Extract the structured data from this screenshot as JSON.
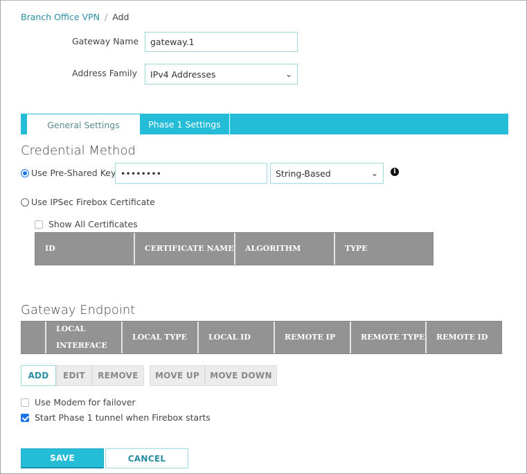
{
  "breadcrumb": {
    "parent": "Branch Office VPN",
    "separator": "/",
    "current": "Add"
  },
  "form": {
    "gateway_name_label": "Gateway Name",
    "gateway_name_value": "gateway.1",
    "address_family_label": "Address Family",
    "address_family_value": "IPv4 Addresses"
  },
  "tabs": [
    {
      "label": "General Settings",
      "active": true
    },
    {
      "label": "Phase 1 Settings",
      "active": false
    }
  ],
  "credential": {
    "title": "Credential Method",
    "psk_label": "Use Pre-Shared Key",
    "psk_selected": true,
    "psk_value": "••••••••",
    "key_type_value": "String-Based",
    "cert_label": "Use IPSec Firebox Certificate",
    "cert_selected": false,
    "show_all_label": "Show All Certificates",
    "show_all_checked": false,
    "cert_columns": [
      "ID",
      "CERTIFICATE NAME",
      "ALGORITHM",
      "TYPE"
    ]
  },
  "endpoint": {
    "title": "Gateway Endpoint",
    "columns": [
      "",
      "LOCAL INTERFACE",
      "LOCAL TYPE",
      "LOCAL ID",
      "REMOTE IP",
      "REMOTE TYPE",
      "REMOTE ID"
    ],
    "buttons": {
      "add": "ADD",
      "edit": "EDIT",
      "remove": "REMOVE",
      "move_up": "MOVE UP",
      "move_down": "MOVE DOWN"
    }
  },
  "options": {
    "modem_label": "Use Modem for failover",
    "modem_checked": false,
    "start_phase1_label": "Start Phase 1 tunnel when Firebox starts",
    "start_phase1_checked": true
  },
  "footer": {
    "save": "SAVE",
    "cancel": "CANCEL"
  },
  "colors": {
    "accent": "#25bcd8",
    "link": "#2a8ea3",
    "header_gray": "#939393"
  }
}
